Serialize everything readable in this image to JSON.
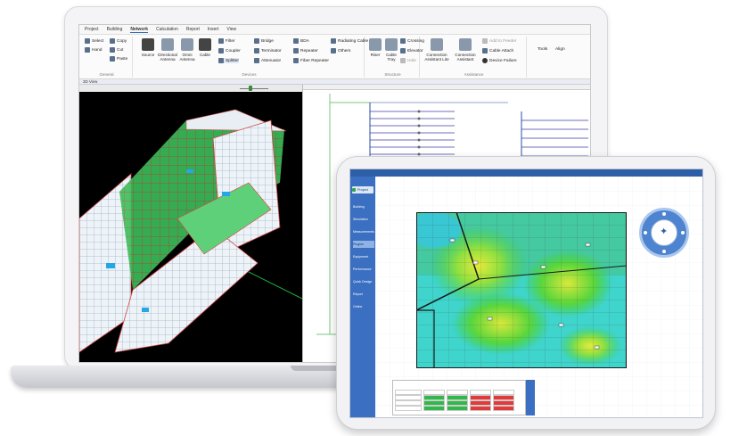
{
  "ribbon_tabs": [
    {
      "label": "Project"
    },
    {
      "label": "Building"
    },
    {
      "label": "Network",
      "active": true
    },
    {
      "label": "Calculation"
    },
    {
      "label": "Report"
    },
    {
      "label": "Insert"
    },
    {
      "label": "View"
    }
  ],
  "ribbon": {
    "general": {
      "label": "General",
      "select": "Select",
      "hand": "Hand",
      "copy": "Copy",
      "cut": "Cut",
      "paste": "Paste"
    },
    "devices": {
      "label": "Devices",
      "source": "Source",
      "directional": "Directional Antenna",
      "omni": "Omni Antenna",
      "cable": "Cable",
      "filter": "Filter",
      "coupler": "Coupler",
      "splitter": "Splitter",
      "bridge": "Bridge",
      "terminator": "Terminator",
      "attenuator": "Attenuator",
      "bda": "BDA",
      "repeater": "Repeater",
      "fiber_repeater": "Fiber Repeater",
      "radiating_cable": "Radiating Cable",
      "others": "Others"
    },
    "structure": {
      "label": "Structure",
      "riser": "Riser",
      "cable_tray": "Cable Tray",
      "crossing": "Crossing",
      "elevator": "Elevator",
      "hole": "Hole"
    },
    "assistance": {
      "label": "Assistance",
      "ca_lite": "Connection Assistant Lite",
      "ca": "Connection Assistant",
      "add_feeder": "Add to Feeder",
      "cable_attach": "Cable Attach",
      "device_failure": "Device Failure"
    },
    "tools": "Tools",
    "align": "Align"
  },
  "laptop": {
    "view3d_tab": "3D View"
  },
  "tablet": {
    "sidebar": {
      "project": "Project",
      "items": [
        {
          "label": "Building"
        },
        {
          "label": "Simulation"
        },
        {
          "label": "Measurements"
        },
        {
          "label": "Plugins",
          "active": true
        },
        {
          "label": "Equipment"
        },
        {
          "label": "Performance"
        },
        {
          "label": "Quick Design"
        },
        {
          "label": "Report"
        },
        {
          "label": "Online"
        }
      ]
    }
  },
  "colors": {
    "ribbon_accent": "#2a6ab0",
    "tablet_sidebar": "#3a6fc2",
    "tablet_titlebar": "#2d5fa8",
    "heatmap_green": "#3fcf3a",
    "heatmap_yellow": "#d9e83a",
    "heatmap_cyan": "#33c9d6",
    "cell_green": "#30b84a",
    "cell_red": "#e23a3a"
  },
  "icons": [
    "select-icon",
    "hand-icon",
    "copy-icon",
    "cut-icon",
    "paste-icon",
    "compass-icon",
    "project-icon"
  ]
}
